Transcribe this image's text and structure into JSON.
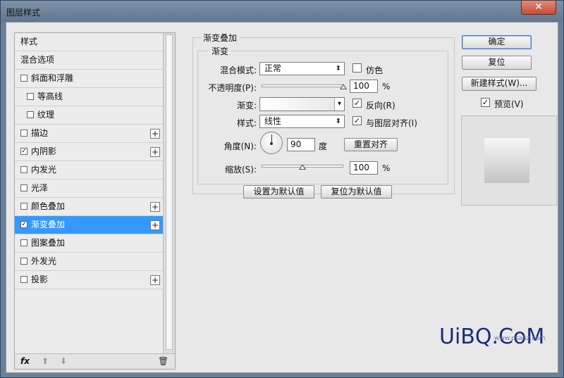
{
  "window": {
    "title": "图层样式",
    "close_glyph": "✕"
  },
  "style_list": {
    "items": [
      {
        "label": "样式",
        "checkbox": false,
        "checked": false,
        "indent": false,
        "plus": false,
        "selected": false
      },
      {
        "label": "混合选项",
        "checkbox": false,
        "checked": false,
        "indent": false,
        "plus": false,
        "selected": false
      },
      {
        "label": "斜面和浮雕",
        "checkbox": true,
        "checked": false,
        "indent": false,
        "plus": false,
        "selected": false
      },
      {
        "label": "等高线",
        "checkbox": true,
        "checked": false,
        "indent": true,
        "plus": false,
        "selected": false
      },
      {
        "label": "纹理",
        "checkbox": true,
        "checked": false,
        "indent": true,
        "plus": false,
        "selected": false
      },
      {
        "label": "描边",
        "checkbox": true,
        "checked": false,
        "indent": false,
        "plus": true,
        "selected": false
      },
      {
        "label": "内阴影",
        "checkbox": true,
        "checked": true,
        "indent": false,
        "plus": true,
        "selected": false
      },
      {
        "label": "内发光",
        "checkbox": true,
        "checked": false,
        "indent": false,
        "plus": false,
        "selected": false
      },
      {
        "label": "光泽",
        "checkbox": true,
        "checked": false,
        "indent": false,
        "plus": false,
        "selected": false
      },
      {
        "label": "颜色叠加",
        "checkbox": true,
        "checked": false,
        "indent": false,
        "plus": true,
        "selected": false
      },
      {
        "label": "渐变叠加",
        "checkbox": true,
        "checked": true,
        "indent": false,
        "plus": true,
        "selected": true
      },
      {
        "label": "图案叠加",
        "checkbox": true,
        "checked": false,
        "indent": false,
        "plus": false,
        "selected": false
      },
      {
        "label": "外发光",
        "checkbox": true,
        "checked": false,
        "indent": false,
        "plus": false,
        "selected": false
      },
      {
        "label": "投影",
        "checkbox": true,
        "checked": false,
        "indent": false,
        "plus": true,
        "selected": false
      }
    ],
    "footer": {
      "fx_label": "fx",
      "up_glyph": "⬆",
      "down_glyph": "⬇",
      "trash_glyph": "🗑"
    }
  },
  "panel": {
    "group_title": "渐变叠加",
    "subgroup_title": "渐变",
    "blend_mode": {
      "label": "混合模式:",
      "value": "正常"
    },
    "dither": {
      "label": "仿色",
      "checked": false
    },
    "opacity": {
      "label": "不透明度(P):",
      "value": "100",
      "unit": "%",
      "level": 1.0
    },
    "gradient": {
      "label": "渐变:"
    },
    "reverse": {
      "label": "反向(R)",
      "checked": true
    },
    "style": {
      "label": "样式:",
      "value": "线性"
    },
    "align": {
      "label": "与图层对齐(I)",
      "checked": true
    },
    "angle": {
      "label": "角度(N):",
      "value": "90",
      "unit": "度"
    },
    "reset_align_button": "重置对齐",
    "scale": {
      "label": "缩放(S):",
      "value": "100",
      "unit": "%",
      "level": 0.5
    },
    "set_default_button": "设置为默认值",
    "reset_default_button": "复位为默认值"
  },
  "actions": {
    "ok": "确定",
    "reset": "复位",
    "new_style": "新建样式(W)...",
    "preview": {
      "label": "预览(V)",
      "checked": true
    }
  },
  "watermark": {
    "text": "UiBQ.CoM",
    "sub": "www.psahz.com"
  },
  "icons": [
    "close-icon",
    "add-effect-icon",
    "fx-icon",
    "move-up-icon",
    "move-down-icon",
    "trash-icon",
    "dropdown-arrow-icon",
    "checkmark-icon"
  ]
}
